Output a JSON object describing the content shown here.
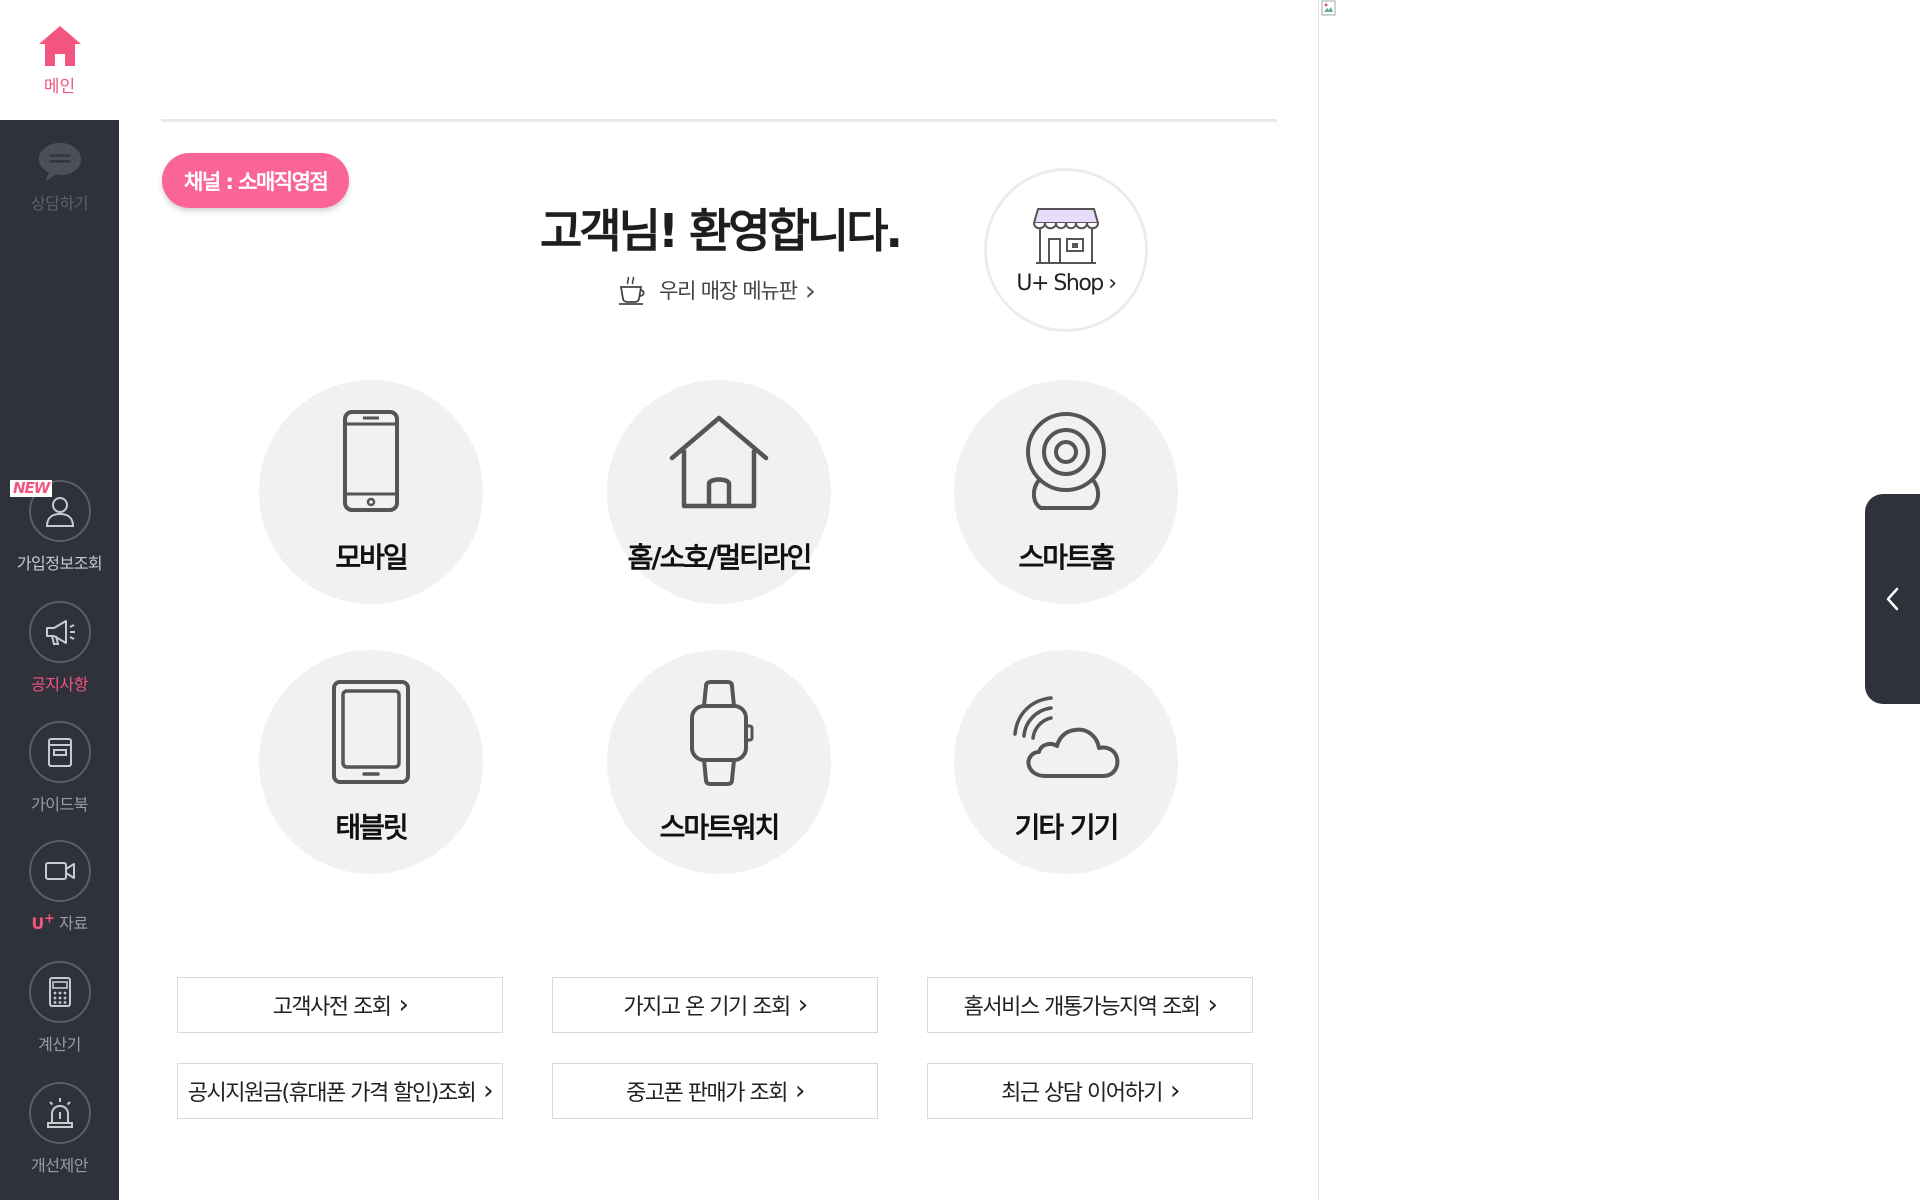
{
  "sidebar": {
    "home": {
      "label": "메인",
      "icon": "home-icon"
    },
    "items": [
      {
        "label": "상담하기",
        "icon": "chat-icon"
      },
      {
        "label": "가입정보조회",
        "icon": "user-icon",
        "badge": "NEW"
      },
      {
        "label": "공지사항",
        "icon": "megaphone-icon"
      },
      {
        "label": "가이드북",
        "icon": "book-icon"
      },
      {
        "label_prefix": "U",
        "label_sup": "+",
        "label": " 자료",
        "icon": "video-icon"
      },
      {
        "label": "계산기",
        "icon": "calculator-icon"
      },
      {
        "label": "개선제안",
        "icon": "siren-icon"
      }
    ]
  },
  "main": {
    "channel_badge": "채널 : 소매직영점",
    "welcome": "고객님! 환영합니다.",
    "menu_link": "우리 매장 메뉴판",
    "shop_button": "U+ Shop",
    "categories": [
      {
        "label": "모바일",
        "icon": "smartphone-icon"
      },
      {
        "label": "홈/소호/멀티라인",
        "icon": "house-icon"
      },
      {
        "label": "스마트홈",
        "icon": "webcam-icon"
      },
      {
        "label": "태블릿",
        "icon": "tablet-icon"
      },
      {
        "label": "스마트워치",
        "icon": "smartwatch-icon"
      },
      {
        "label": "기타 기기",
        "icon": "cloud-signal-icon"
      }
    ],
    "quick_links": [
      "고객사전 조회",
      "가지고 온 기기 조회",
      "홈서비스 개통가능지역 조회",
      "공시지원금(휴대폰 가격 할인)조회",
      "중고폰 판매가 조회",
      "최근 상담 이어하기"
    ],
    "chevron": "›"
  },
  "colors": {
    "accent": "#f2557f",
    "badge": "#fb6596",
    "sidebar_bg": "#30323b",
    "circle_bg": "#f1f1f1"
  }
}
